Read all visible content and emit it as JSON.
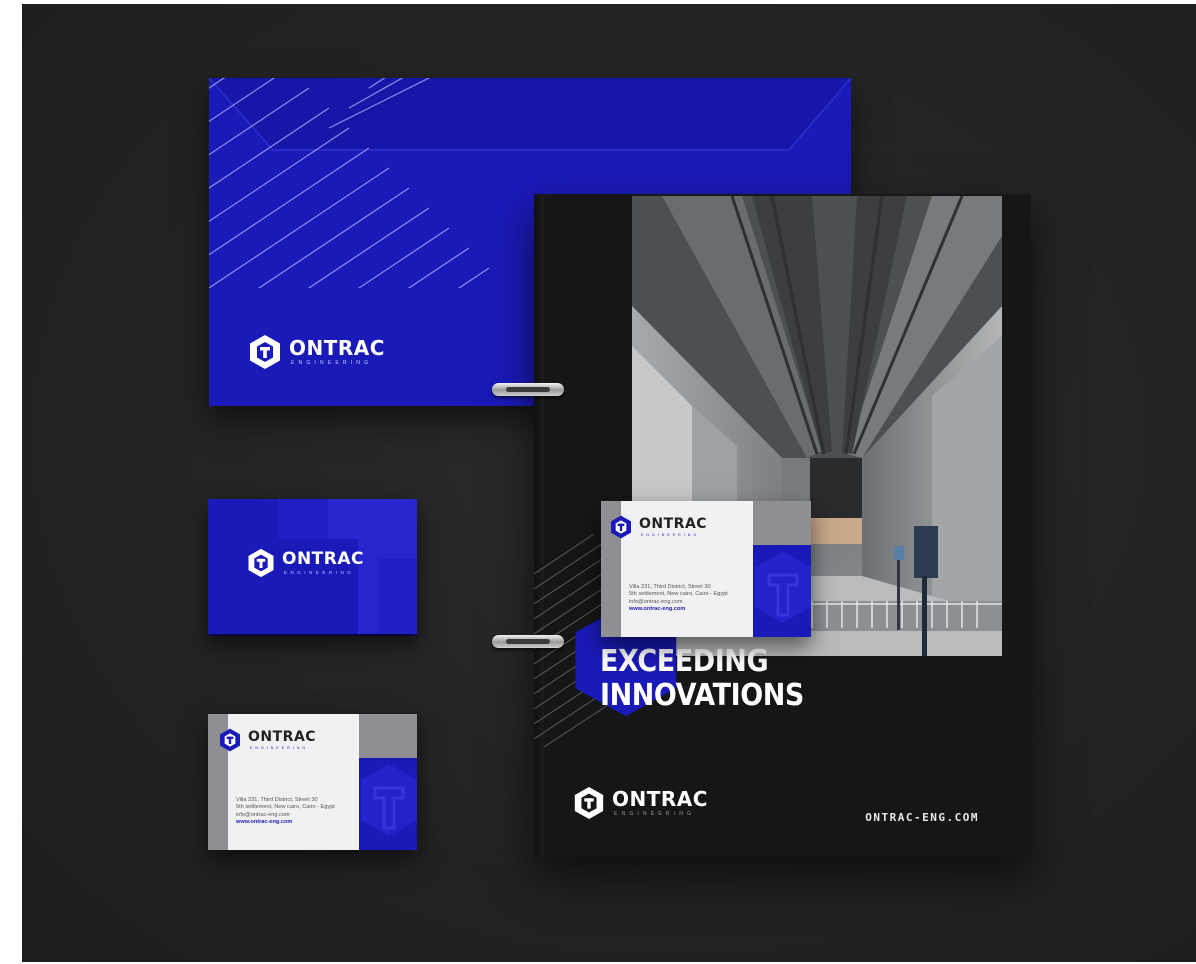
{
  "brand": {
    "name": "ONTRAC",
    "tagline": "ENGINEERING"
  },
  "folder": {
    "headline_line1": "EXCEEDING",
    "headline_line2": "INNOVATIONS",
    "url": "ONTRAC-ENG.COM"
  },
  "card": {
    "address_line1": "Villa 231, Third District, Street 30",
    "address_line2": "5th settlement, New cairo, Cairo - Egypt",
    "email": "info@ontrac-eng.com",
    "website": "www.ontrac-eng.com"
  },
  "colors": {
    "brand_blue": "#1a1ab8",
    "background": "#232324",
    "folder_black": "#161617",
    "card_gray": "#8e8e93"
  },
  "icons": [
    "hexagon-logo-icon"
  ]
}
